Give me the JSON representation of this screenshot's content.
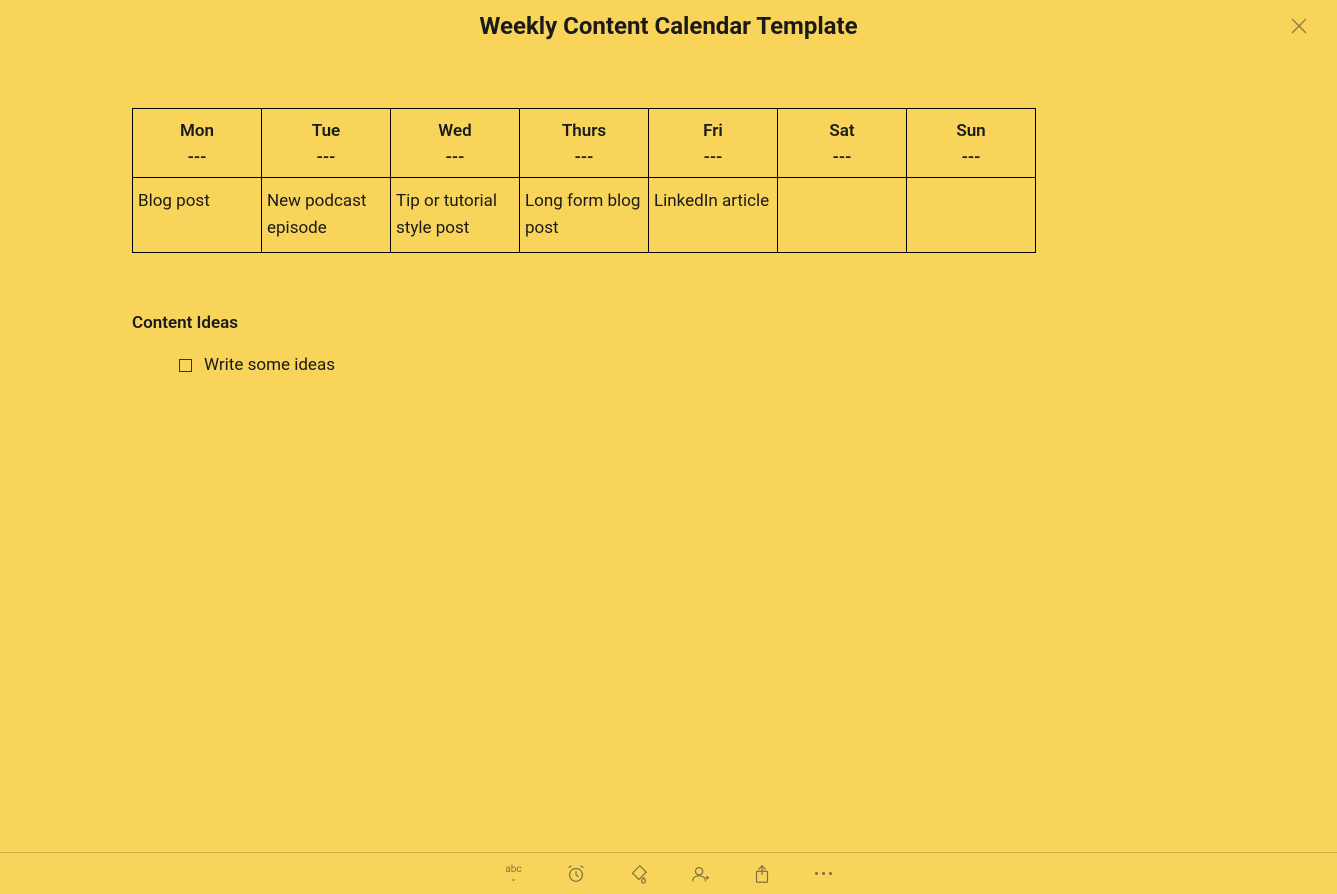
{
  "title": "Weekly Content Calendar Template",
  "days": [
    {
      "name": "Mon",
      "sub": "---",
      "content": "Blog post"
    },
    {
      "name": "Tue",
      "sub": "---",
      "content": "New podcast episode"
    },
    {
      "name": "Wed",
      "sub": "---",
      "content": "Tip or tutorial style post"
    },
    {
      "name": "Thurs",
      "sub": "---",
      "content": "Long form blog post"
    },
    {
      "name": "Fri",
      "sub": "---",
      "content": "LinkedIn article"
    },
    {
      "name": "Sat",
      "sub": "---",
      "content": ""
    },
    {
      "name": "Sun",
      "sub": "---",
      "content": ""
    }
  ],
  "sections": {
    "ideas_heading": "Content Ideas"
  },
  "checklist": [
    {
      "label": "Write some ideas",
      "checked": false
    }
  ],
  "toolbar": {
    "spellcheck_label": "abc"
  }
}
